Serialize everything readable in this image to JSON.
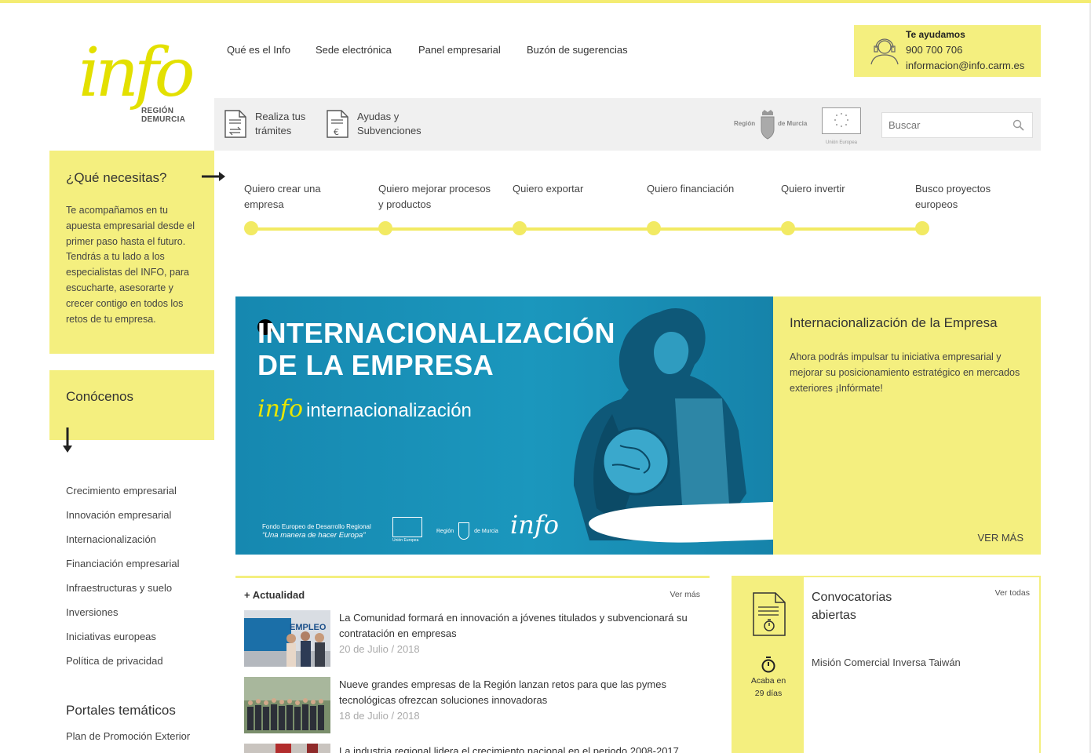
{
  "colors": {
    "accent_yellow": "#f4ef7f",
    "banner_blue": "#1a8fb5"
  },
  "logo": {
    "word": "info",
    "line1": "REGIÓN",
    "line2": "DEMURCIA"
  },
  "nav": [
    "Qué es el Info",
    "Sede electrónica",
    "Panel empresarial",
    "Buzón de sugerencias"
  ],
  "help": {
    "title": "Te ayudamos",
    "phone": "900 700 706",
    "email": "informacion@info.carm.es"
  },
  "toolbar": {
    "tramites_l1": "Realiza tus",
    "tramites_l2": "trámites",
    "ayudas_l1": "Ayudas y",
    "ayudas_l2": "Subvenciones",
    "search_placeholder": "Buscar",
    "region_label_1": "Región",
    "region_label_2": "de Murcia",
    "ue_label": "Unión Europea"
  },
  "need": {
    "title": "¿Qué necesitas?",
    "text": "Te acompañamos en tu apuesta empresarial desde el primer paso hasta el futuro. Tendrás a tu lado a los especialistas del INFO, para escucharte, asesorarte y crecer contigo en todos los retos de tu empresa."
  },
  "steps": [
    {
      "l1": "Quiero crear una",
      "l2": "empresa"
    },
    {
      "l1": "Quiero mejorar procesos",
      "l2": "y productos"
    },
    {
      "l1": "Quiero exportar",
      "l2": ""
    },
    {
      "l1": "Quiero financiación",
      "l2": ""
    },
    {
      "l1": "Quiero invertir",
      "l2": ""
    },
    {
      "l1": "Busco proyectos",
      "l2": "europeos"
    }
  ],
  "conocenos": {
    "title": "Conócenos"
  },
  "sidelinks": [
    "Crecimiento empresarial",
    "Innovación empresarial",
    "Internacionalización",
    "Financiación empresarial",
    "Infraestructuras y suelo",
    "Inversiones",
    "Iniciativas europeas",
    "Política de privacidad"
  ],
  "portales": {
    "title": "Portales temáticos",
    "first": "Plan de Promoción Exterior"
  },
  "banner": {
    "title_l1": "INTERNACIONALIZACIÓN",
    "title_l2": "DE LA EMPRESA",
    "sub_info": "info",
    "sub": "internacionalización",
    "fondo_l1": "Fondo Europeo de Desarrollo Regional",
    "fondo_l2": "“Una manera de hacer Europa”",
    "ue": "Unión Europea",
    "region": "Región",
    "murcia": "de Murcia",
    "info": "info"
  },
  "feature": {
    "title": "Internacionalización de la Empresa",
    "text": "Ahora podrás impulsar tu iniciativa empresarial y mejorar su posicionamiento estratégico en mercados exteriores ¡Infórmate!",
    "cta": "VER MÁS"
  },
  "news": {
    "title": "+ Actualidad",
    "more": "Ver más",
    "items": [
      {
        "title": "La Comunidad formará en innovación a jóvenes titulados y subvencionará su contratación en empresas",
        "date": "20 de Julio / 2018"
      },
      {
        "title": "Nueve grandes empresas de la Región lanzan retos para que las pymes tecnológicas ofrezcan soluciones innovadoras",
        "date": "18 de Julio / 2018"
      },
      {
        "title": "La industria regional lidera el crecimiento nacional en el periodo 2008-2017",
        "date": ""
      }
    ]
  },
  "convocatorias": {
    "title_l1": "Convocatorias",
    "title_l2": "abiertas",
    "all": "Ver todas",
    "ends_l1": "Acaba en",
    "ends_l2": "29 días",
    "item": "Misión Comercial Inversa Taiwán"
  }
}
